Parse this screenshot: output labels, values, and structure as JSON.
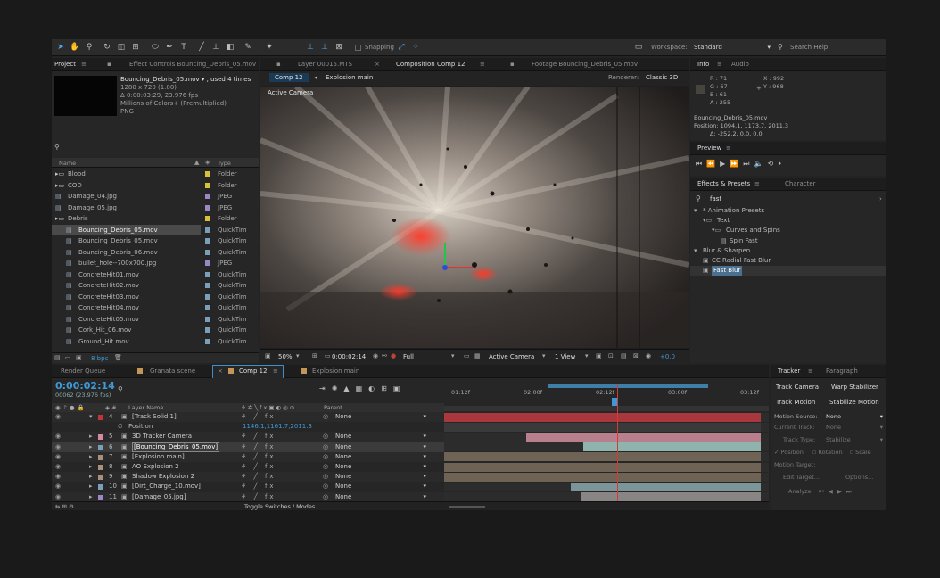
{
  "toolbar": {
    "snapping": "Snapping",
    "workspace_label": "Workspace:",
    "workspace_value": "Standard",
    "search_help": "Search Help"
  },
  "project": {
    "tabs": [
      "Project",
      "Effect Controls Bouncing_Debris_05.mov"
    ],
    "file_name": "Bouncing_Debris_05.mov ▾ , used 4 times",
    "file_info": [
      "1280 x 720 (1.00)",
      "Δ 0:00:03:29, 23.976 fps",
      "Millions of Colors+ (Premultiplied)",
      "PNG"
    ],
    "col_name": "Name",
    "col_type": "Type",
    "items": [
      {
        "name": "Blood",
        "type": "Folder",
        "color": "#d8c03a",
        "indent": 0,
        "kind": "folder"
      },
      {
        "name": "COD",
        "type": "Folder",
        "color": "#d8c03a",
        "indent": 0,
        "kind": "folder"
      },
      {
        "name": "Damage_04.jpg",
        "type": "JPEG",
        "color": "#9b86c8",
        "indent": 0,
        "kind": "file"
      },
      {
        "name": "Damage_05.jpg",
        "type": "JPEG",
        "color": "#9b86c8",
        "indent": 0,
        "kind": "file"
      },
      {
        "name": "Debris",
        "type": "Folder",
        "color": "#d8c03a",
        "indent": 0,
        "kind": "folder"
      },
      {
        "name": "Bouncing_Debris_05.mov",
        "type": "QuickTim",
        "color": "#7a9fb8",
        "indent": 1,
        "kind": "file",
        "selected": true
      },
      {
        "name": "Bouncing_Debris_05.mov",
        "type": "QuickTim",
        "color": "#7a9fb8",
        "indent": 1,
        "kind": "file"
      },
      {
        "name": "Bouncing_Debris_06.mov",
        "type": "QuickTim",
        "color": "#7a9fb8",
        "indent": 1,
        "kind": "file"
      },
      {
        "name": "bullet_hole--700x700.jpg",
        "type": "JPEG",
        "color": "#9b86c8",
        "indent": 1,
        "kind": "file"
      },
      {
        "name": "ConcreteHit01.mov",
        "type": "QuickTim",
        "color": "#7a9fb8",
        "indent": 1,
        "kind": "file"
      },
      {
        "name": "ConcreteHit02.mov",
        "type": "QuickTim",
        "color": "#7a9fb8",
        "indent": 1,
        "kind": "file"
      },
      {
        "name": "ConcreteHit03.mov",
        "type": "QuickTim",
        "color": "#7a9fb8",
        "indent": 1,
        "kind": "file"
      },
      {
        "name": "ConcreteHit04.mov",
        "type": "QuickTim",
        "color": "#7a9fb8",
        "indent": 1,
        "kind": "file"
      },
      {
        "name": "ConcreteHit05.mov",
        "type": "QuickTim",
        "color": "#7a9fb8",
        "indent": 1,
        "kind": "file"
      },
      {
        "name": "Cork_Hit_06.mov",
        "type": "QuickTim",
        "color": "#7a9fb8",
        "indent": 1,
        "kind": "file"
      },
      {
        "name": "Ground_Hit.mov",
        "type": "QuickTim",
        "color": "#7a9fb8",
        "indent": 1,
        "kind": "file"
      }
    ],
    "bpc": "8 bpc"
  },
  "viewer": {
    "tabs": [
      "Layer 00015.MTS",
      "Composition Comp 12",
      "Footage Bouncing_Debris_05.mov"
    ],
    "comp_tab": "Comp 12",
    "explosion_tab": "Explosion main",
    "renderer_label": "Renderer:",
    "renderer_value": "Classic 3D",
    "active_camera_overlay": "Active Camera",
    "zoom": "50%",
    "timecode": "0:00:02:14",
    "resolution": "Full",
    "view": "Active Camera",
    "views": "1 View",
    "exposure": "+0.0"
  },
  "info": {
    "tabs": [
      "Info",
      "Audio"
    ],
    "r": "R : 71",
    "g": "G : 67",
    "b": "B : 61",
    "a": "A : 255",
    "x": "X : 992",
    "y": "Y : 968",
    "layer": "Bouncing_Debris_05.mov",
    "position": "Position: 1094.1, 1173.7, 2011.3",
    "delta": "Δ: -252.2, 0.0, 0.0"
  },
  "preview": {
    "title": "Preview"
  },
  "effects": {
    "tabs": [
      "Effects & Presets",
      "Character"
    ],
    "search": "fast",
    "items": [
      {
        "label": "* Animation Presets",
        "level": 0,
        "kind": "arrow"
      },
      {
        "label": "Text",
        "level": 1,
        "kind": "folder"
      },
      {
        "label": "Curves and Spins",
        "level": 2,
        "kind": "folder"
      },
      {
        "label": "Spin Fast",
        "level": 3,
        "kind": "preset"
      },
      {
        "label": "Blur & Sharpen",
        "level": 0,
        "kind": "arrow"
      },
      {
        "label": "CC Radial Fast Blur",
        "level": 1,
        "kind": "fx"
      },
      {
        "label": "Fast Blur",
        "level": 1,
        "kind": "fx",
        "selected": true
      }
    ]
  },
  "timeline": {
    "tabs": [
      "Render Queue",
      "Granata scene",
      "Comp 12",
      "Explosion main"
    ],
    "timecode": "0:00:02:14",
    "fps": "00062 (23.976 fps)",
    "col_layer": "Layer Name",
    "col_parent": "Parent",
    "ruler": [
      "01:12f",
      "02:00f",
      "02:12f",
      "03:00f",
      "03:12f"
    ],
    "layers": [
      {
        "num": "4",
        "name": "[Track Solid 1]",
        "color": "#c0343a",
        "parent": "None",
        "bar_color": "#a8373e",
        "bar_start": 0,
        "bar_end": 1,
        "selected": false
      },
      {
        "num": "",
        "name": "Position",
        "color": "",
        "parent": "",
        "value": "1146.1,1161.7,2011.3",
        "prop": true,
        "bar_color": "#3a3a3a",
        "bar_start": 0,
        "bar_end": 1
      },
      {
        "num": "5",
        "name": "3D Tracker Camera",
        "color": "#d48aa0",
        "parent": "None",
        "bar_color": "#b7808c",
        "bar_start": 0.26,
        "bar_end": 1
      },
      {
        "num": "6",
        "name": "[Bouncing_Debris_05.mov]",
        "color": "#7a9fb8",
        "parent": "None",
        "bar_color": "#8fb4ae",
        "bar_start": 0.44,
        "bar_end": 1,
        "selected": true
      },
      {
        "num": "7",
        "name": "[Explosion main]",
        "color": "#a8907a",
        "parent": "None",
        "bar_color": "#6e6355",
        "bar_start": 0,
        "bar_end": 1
      },
      {
        "num": "8",
        "name": "AO Explosion 2",
        "color": "#a8907a",
        "parent": "None",
        "bar_color": "#6e6355",
        "bar_start": 0,
        "bar_end": 1
      },
      {
        "num": "9",
        "name": "Shadow Explosion 2",
        "color": "#a8907a",
        "parent": "None",
        "bar_color": "#6e6355",
        "bar_start": 0,
        "bar_end": 1
      },
      {
        "num": "10",
        "name": "[Dirt_Charge_10.mov]",
        "color": "#7a9fb8",
        "parent": "None",
        "bar_color": "#7b9598",
        "bar_start": 0.4,
        "bar_end": 1
      },
      {
        "num": "11",
        "name": "[Damage_05.jpg]",
        "color": "#9b86c8",
        "parent": "None",
        "bar_color": "#8a8585",
        "bar_start": 0.43,
        "bar_end": 1
      }
    ],
    "toggle": "Toggle Switches / Modes"
  },
  "tracker": {
    "tabs": [
      "Tracker",
      "Paragraph"
    ],
    "track_camera": "Track Camera",
    "warp_stabilizer": "Warp Stabilizer",
    "track_motion": "Track Motion",
    "stabilize_motion": "Stabilize Motion",
    "motion_source_label": "Motion Source:",
    "motion_source": "None",
    "current_track_label": "Current Track:",
    "current_track": "None",
    "track_type_label": "Track Type:",
    "track_type": "Stabilize",
    "position": "Position",
    "rotation": "Rotation",
    "scale": "Scale",
    "motion_target": "Motion Target:",
    "edit_target": "Edit Target...",
    "options": "Options...",
    "analyze": "Analyze:"
  }
}
